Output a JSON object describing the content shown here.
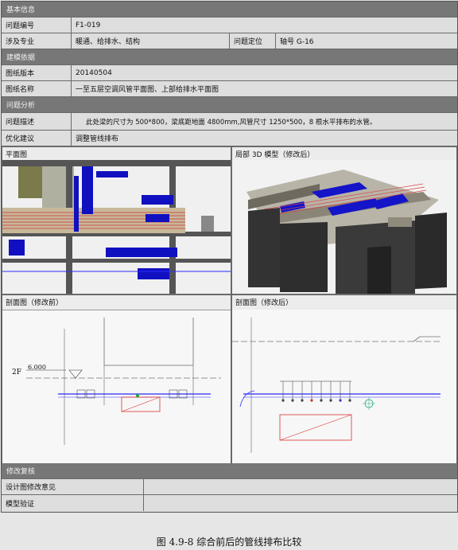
{
  "basic_info": {
    "header": "基本信息",
    "issue_no_label": "问题编号",
    "issue_no_value": "F1-019",
    "discipline_label": "涉及专业",
    "discipline_value": "暖通、给排水、结构",
    "location_label": "问题定位",
    "location_value": "轴号 G-16"
  },
  "basis": {
    "header": "建模依据",
    "version_label": "图纸版本",
    "version_value": "20140504",
    "name_label": "图纸名称",
    "name_value": "一至五层空调风管平面图、上部给排水平面图"
  },
  "analysis": {
    "header": "问题分析",
    "desc_label": "问题描述",
    "desc_value": "此处梁的尺寸为 500*800，梁底距地面 4800mm,风管尺寸 1250*500，8 根水平排布的水管。",
    "suggest_label": "优化建议",
    "suggest_value": "调整管线排布"
  },
  "panels": {
    "plan_title": "平面图",
    "model3d_title": "局部 3D 模型（修改后）",
    "section_before_title": "剖面图（修改前）",
    "section_after_title": "剖面图（修改后）",
    "section_level_label": "2F",
    "section_level_value": "6.000"
  },
  "review": {
    "header": "修改复核",
    "design_label": "设计图修改意见",
    "design_value": "",
    "model_label": "模型验证",
    "model_value": ""
  },
  "caption": "图 4.9-8  综合前后的管线排布比较"
}
